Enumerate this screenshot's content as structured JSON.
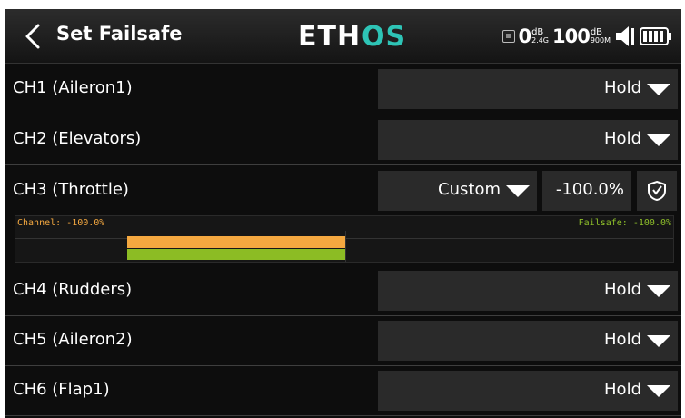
{
  "header": {
    "title": "Set Failsafe",
    "logo": "ETHOS",
    "rssi_2g4": {
      "value": "0",
      "unit": "dB",
      "band": "2.4G"
    },
    "rssi_900m": {
      "value": "100",
      "unit": "dB",
      "band": "900M"
    }
  },
  "channels": [
    {
      "label": "CH1 (Aileron1)",
      "mode": "Hold"
    },
    {
      "label": "CH2 (Elevators)",
      "mode": "Hold"
    },
    {
      "label": "CH3 (Throttle)",
      "mode": "Custom",
      "value": "-100.0%"
    },
    {
      "label": "CH4 (Rudders)",
      "mode": "Hold"
    },
    {
      "label": "CH5 (Aileron2)",
      "mode": "Hold"
    },
    {
      "label": "CH6 (Flap1)",
      "mode": "Hold"
    }
  ],
  "bar": {
    "channel_label": "Channel: -100.0%",
    "failsafe_label": "Failsafe: -100.0%",
    "channel_value": -100.0,
    "failsafe_value": -100.0
  },
  "colors": {
    "channel": "#f4a840",
    "failsafe": "#8cbc24",
    "logo_accent": "#2ec4b6"
  },
  "icons": {
    "back": "chevron-left-icon",
    "set": "shield-check-icon",
    "speaker": "speaker-icon",
    "battery": "battery-icon"
  }
}
